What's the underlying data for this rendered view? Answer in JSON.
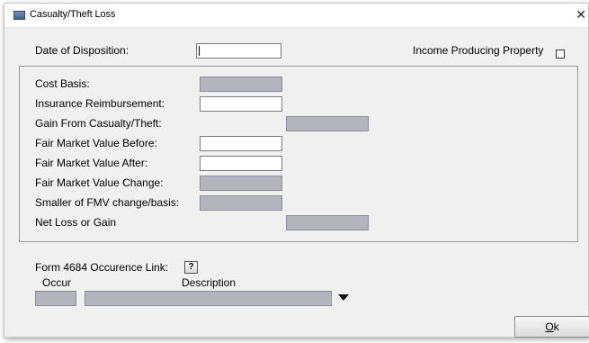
{
  "window": {
    "title": "Casualty/Theft Loss",
    "close_symbol": "✕"
  },
  "top": {
    "date_of_disposition_label": "Date of Disposition:",
    "date_of_disposition_value": "",
    "income_producing_label": "Income Producing Property",
    "income_producing_checked": false
  },
  "fields": {
    "cost_basis": "Cost Basis:",
    "insurance_reimbursement": "Insurance Reimbursement:",
    "gain_from_casualty": "Gain From Casualty/Theft:",
    "fmv_before": "Fair Market Value Before:",
    "fmv_after": "Fair Market Value After:",
    "fmv_change": "Fair Market Value Change:",
    "smaller_of": "Smaller of FMV change/basis:",
    "net_loss_or_gain": "Net Loss or Gain"
  },
  "values": {
    "cost_basis": "",
    "insurance_reimbursement": "",
    "gain_from_casualty": "",
    "fmv_before": "",
    "fmv_after": "",
    "fmv_change": "",
    "smaller_of": "",
    "net_loss_or_gain": ""
  },
  "link": {
    "label": "Form 4684 Occurence Link:",
    "help_label": "?",
    "occur_header": "Occur",
    "description_header": "Description",
    "occur_value": "",
    "description_value": ""
  },
  "buttons": {
    "ok_label": "Ok",
    "ok_mnemonic": "O",
    "ok_rest": "k"
  },
  "icons": {
    "app": "window-icon",
    "close": "close-icon",
    "dropdown": "chevron-down-icon"
  }
}
